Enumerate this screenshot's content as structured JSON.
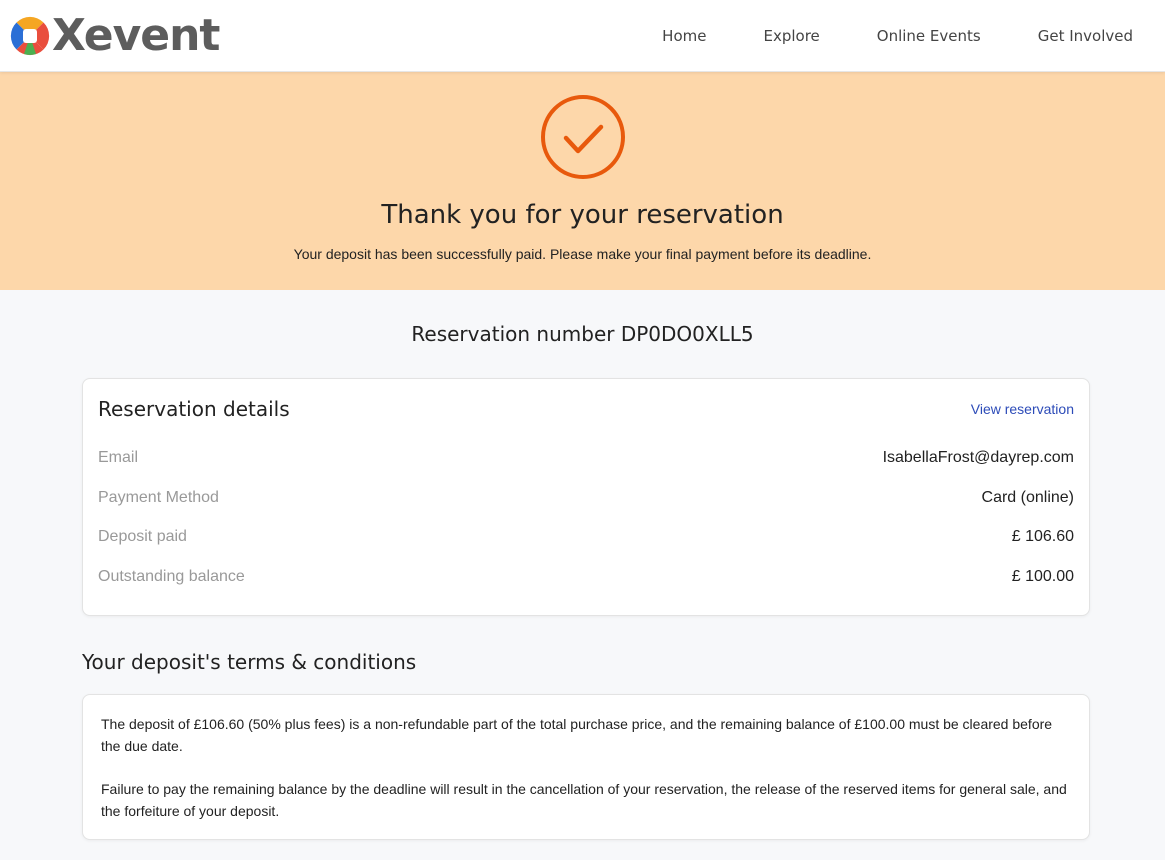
{
  "brand": {
    "name": "Xevent",
    "logo_colors": [
      "#f5a623",
      "#e94e3d",
      "#4caf50",
      "#2b6fd6"
    ]
  },
  "nav": {
    "items": [
      "Home",
      "Explore",
      "Online Events",
      "Get Involved"
    ]
  },
  "hero": {
    "title": "Thank you for your reservation",
    "message": "Your deposit has been successfully paid. Please make your final payment before its deadline.",
    "icon": "check-circle-icon",
    "accent": "#e8590c",
    "background": "#fdd7aa"
  },
  "reservation_number": "Reservation number DP0DO0XLL5",
  "details": {
    "title": "Reservation details",
    "view_link": "View reservation",
    "rows": [
      {
        "label": "Email",
        "value": "IsabellaFrost@dayrep.com"
      },
      {
        "label": "Payment Method",
        "value": "Card (online)"
      },
      {
        "label": "Deposit paid",
        "value": "£ 106.60"
      },
      {
        "label": "Outstanding balance",
        "value": "£ 100.00"
      }
    ]
  },
  "terms": {
    "title": "Your deposit's terms & conditions",
    "paragraphs": [
      "The deposit of £106.60 (50% plus fees) is a non-refundable part of the total purchase price, and the remaining balance of £100.00 must be cleared before the due date.",
      "Failure to pay the remaining balance by the deadline will result in the cancellation of your reservation, the release of the reserved items for general sale, and the forfeiture of your deposit."
    ]
  }
}
